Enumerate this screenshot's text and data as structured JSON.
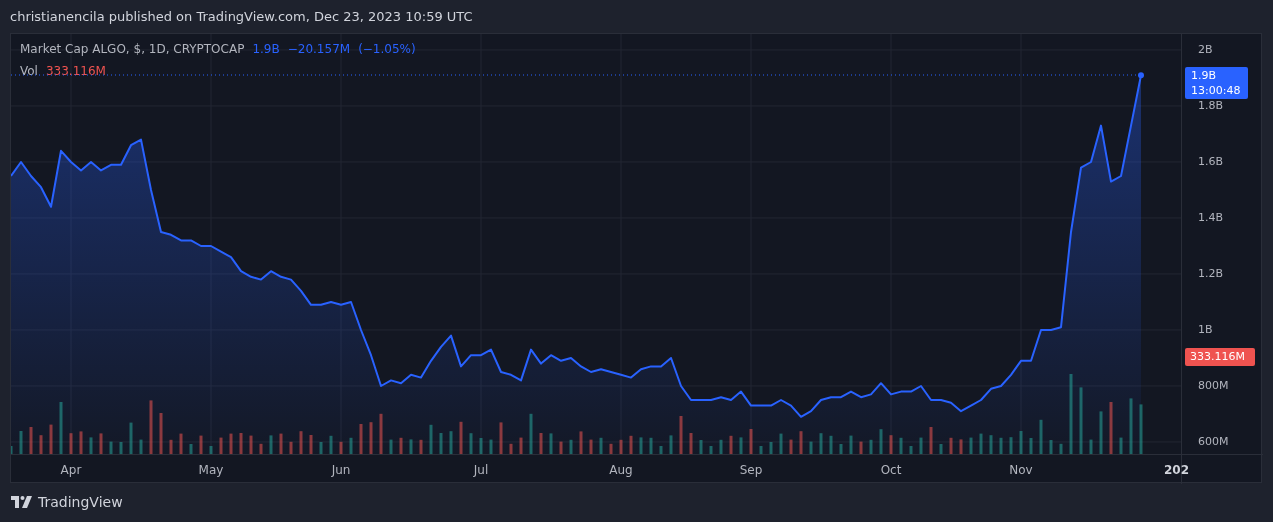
{
  "header": {
    "text": "christianencila published on TradingView.com, Dec 23, 2023 10:59 UTC"
  },
  "legend": {
    "title": "Market Cap ALGO, $, 1D, CRYPTOCAP",
    "value": "1.9B",
    "change": "−20.157M",
    "change_pct": "(−1.05%)",
    "volume_label": "Vol",
    "volume_value": "333.116M"
  },
  "chart": {
    "chart_data": {
      "type": "area",
      "grid": true,
      "ylim": [
        557000000,
        2057000000
      ],
      "categories": [
        null,
        null,
        null,
        null,
        null,
        null,
        "Apr",
        null,
        null,
        null,
        null,
        null,
        null,
        null,
        null,
        null,
        null,
        null,
        null,
        null,
        "May",
        null,
        null,
        null,
        null,
        null,
        null,
        null,
        null,
        null,
        null,
        null,
        null,
        "Jun",
        null,
        null,
        null,
        null,
        null,
        null,
        null,
        null,
        null,
        null,
        null,
        null,
        null,
        "Jul",
        null,
        null,
        null,
        null,
        null,
        null,
        null,
        null,
        null,
        null,
        null,
        null,
        null,
        "Aug",
        null,
        null,
        null,
        null,
        null,
        null,
        null,
        null,
        null,
        null,
        null,
        null,
        "Sep",
        null,
        null,
        null,
        null,
        null,
        null,
        null,
        null,
        null,
        null,
        null,
        null,
        null,
        "Oct",
        null,
        null,
        null,
        null,
        null,
        null,
        null,
        null,
        null,
        null,
        null,
        null,
        "Nov",
        null,
        null,
        null,
        null,
        null,
        null,
        null,
        null,
        null,
        null,
        null,
        null
      ],
      "yticks": [
        {
          "value": 600000000,
          "label": "600M"
        },
        {
          "value": 800000000,
          "label": "800M"
        },
        {
          "value": 1000000000,
          "label": "1B"
        },
        {
          "value": 1200000000,
          "label": "1.2B"
        },
        {
          "value": 1400000000,
          "label": "1.4B"
        },
        {
          "value": 1600000000,
          "label": "1.6B"
        },
        {
          "value": 1800000000,
          "label": "1.8B"
        },
        {
          "value": 2000000000,
          "label": "2B"
        }
      ],
      "series": [
        {
          "color": "#2962ff",
          "values": [
            1550000000.0,
            1600000000.0,
            1550000000.0,
            1510000000.0,
            1440000000.0,
            1640000000.0,
            1600000000.0,
            1570000000.0,
            1600000000.0,
            1570000000.0,
            1590000000.0,
            1590000000.0,
            1660000000.0,
            1680000000.0,
            1500000000.0,
            1350000000.0,
            1340000000.0,
            1320000000.0,
            1320000000.0,
            1300000000.0,
            1300000000.0,
            1280000000.0,
            1260000000.0,
            1210000000.0,
            1190000000.0,
            1180000000.0,
            1210000000.0,
            1190000000.0,
            1180000000.0,
            1140000000.0,
            1090000000.0,
            1090000000.0,
            1100000000.0,
            1090000000.0,
            1100000000.0,
            1000000000.0,
            910000000.0,
            800000000.0,
            820000000.0,
            810000000.0,
            840000000.0,
            830000000.0,
            890000000.0,
            940000000.0,
            980000000.0,
            870000000.0,
            910000000.0,
            910000000.0,
            930000000.0,
            850000000.0,
            840000000.0,
            820000000.0,
            930000000.0,
            880000000.0,
            910000000.0,
            890000000.0,
            900000000.0,
            870000000.0,
            850000000.0,
            860000000.0,
            850000000.0,
            840000000.0,
            830000000.0,
            860000000.0,
            870000000.0,
            870000000.0,
            900000000.0,
            800000000.0,
            750000000.0,
            750000000.0,
            750000000.0,
            760000000.0,
            750000000.0,
            780000000.0,
            730000000.0,
            730000000.0,
            730000000.0,
            750000000.0,
            730000000.0,
            690000000.0,
            710000000.0,
            750000000.0,
            760000000.0,
            760000000.0,
            780000000.0,
            760000000.0,
            770000000.0,
            810000000.0,
            770000000.0,
            780000000.0,
            780000000.0,
            800000000.0,
            750000000.0,
            750000000.0,
            740000000.0,
            710000000.0,
            730000000.0,
            750000000.0,
            790000000.0,
            800000000.0,
            840000000.0,
            890000000.0,
            890000000.0,
            1000000000.0,
            1000000000.0,
            1010000000.0,
            1350000000.0,
            1580000000.0,
            1600000000.0,
            1730000000.0,
            1530000000.0,
            1550000000.0,
            1730000000.0,
            1910000000.0
          ]
        }
      ]
    }
  },
  "time_axis_edge_label": "202",
  "price_axis": {
    "price_tag": {
      "value": "1.9B",
      "countdown": "13:00:48"
    },
    "volume_tag": "333.116M"
  },
  "footer": {
    "brand": "TradingView"
  }
}
